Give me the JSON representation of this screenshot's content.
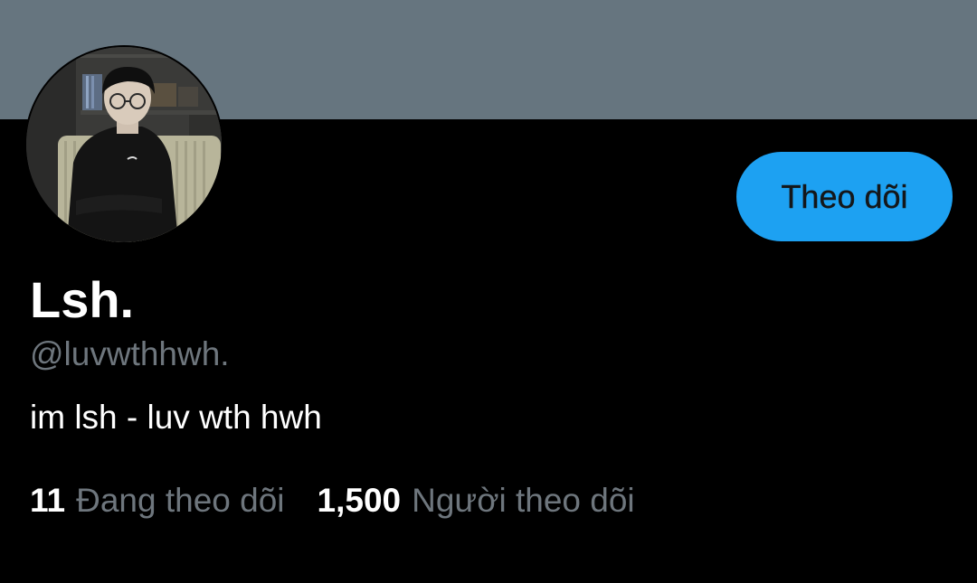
{
  "profile": {
    "display_name": "Lsh.",
    "handle": "@luvwthhwh.",
    "bio": "im lsh - luv wth hwh",
    "follow_button_label": "Theo dõi",
    "following_count": "11",
    "following_label": "Đang theo dõi",
    "followers_count": "1,500",
    "followers_label": "Người theo dõi"
  },
  "colors": {
    "background": "#000000",
    "banner": "#66757f",
    "accent": "#1da1f2",
    "text_primary": "#ffffff",
    "text_secondary": "#6e767d"
  },
  "icons": {
    "avatar": "profile-photo"
  }
}
